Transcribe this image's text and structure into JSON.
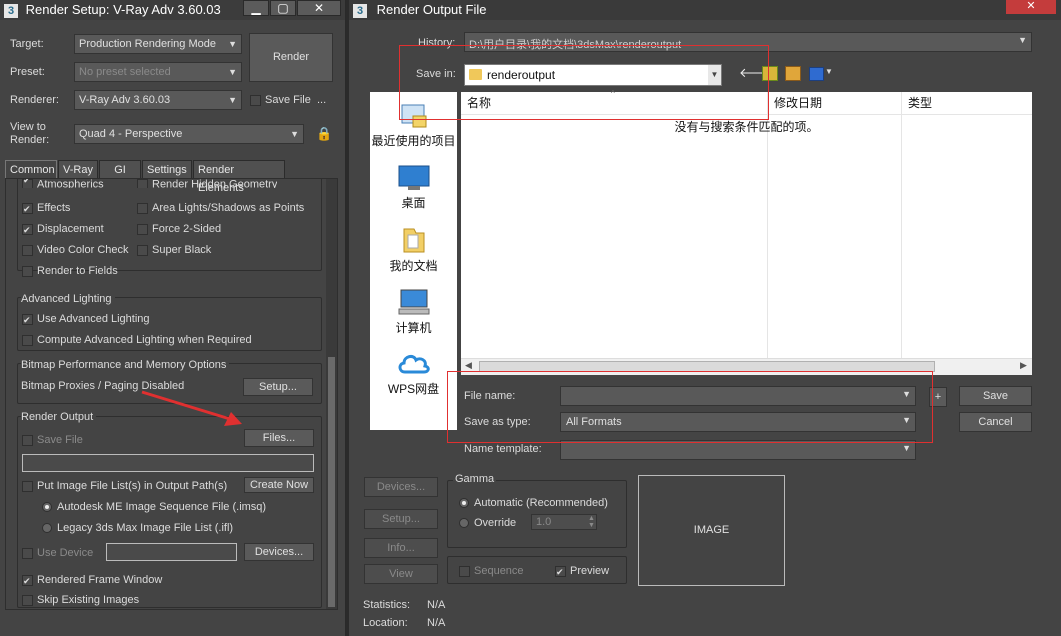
{
  "render_setup": {
    "title": "Render Setup: V-Ray Adv 3.60.03",
    "target_label": "Target:",
    "target_value": "Production Rendering Mode",
    "preset_label": "Preset:",
    "preset_value": "No preset selected",
    "renderer_label": "Renderer:",
    "renderer_value": "V-Ray Adv 3.60.03",
    "save_file_label": "Save File",
    "more_label": "...",
    "view_label": "View to Render:",
    "view_value": "Quad 4 - Perspective",
    "render_button": "Render",
    "tabs": [
      "Common",
      "V-Ray",
      "GI",
      "Settings",
      "Render Elements"
    ],
    "options": {
      "atmospherics": "Atmospherics",
      "render_hidden": "Render Hidden Geometry",
      "effects": "Effects",
      "area_lights": "Area Lights/Shadows as Points",
      "displacement": "Displacement",
      "force_2sided": "Force 2-Sided",
      "video_color": "Video Color Check",
      "super_black": "Super Black",
      "render_fields": "Render to Fields"
    },
    "advanced_lighting": {
      "title": "Advanced Lighting",
      "use_adv": "Use Advanced Lighting",
      "compute_adv": "Compute Advanced Lighting when Required"
    },
    "bitmap": {
      "title": "Bitmap Performance and Memory Options",
      "status": "Bitmap Proxies / Paging Disabled",
      "setup_button": "Setup..."
    },
    "render_output": {
      "title": "Render Output",
      "save_file": "Save File",
      "files_button": "Files...",
      "put_image_list": "Put Image File List(s) in Output Path(s)",
      "create_now": "Create Now",
      "autodesk_me": "Autodesk ME Image Sequence File (.imsq)",
      "legacy": "Legacy 3ds Max Image File List (.ifl)",
      "use_device": "Use Device",
      "devices_button": "Devices...",
      "rendered_frame": "Rendered Frame Window",
      "skip_existing": "Skip Existing Images"
    }
  },
  "output_file": {
    "title": "Render Output File",
    "history_label": "History:",
    "history_value": "D:\\用户目录\\我的文档\\3dsMax\\renderoutput",
    "save_in_label": "Save in:",
    "save_in_value": "renderoutput",
    "nav_items": [
      "最近使用的项目",
      "桌面",
      "我的文档",
      "计算机",
      "WPS网盘"
    ],
    "columns": [
      "名称",
      "修改日期",
      "类型"
    ],
    "empty_message": "没有与搜索条件匹配的项。",
    "file_name_label": "File name:",
    "save_type_label": "Save as type:",
    "save_type_value": "All Formats",
    "name_template_label": "Name template:",
    "save_button": "Save",
    "cancel_button": "Cancel",
    "plus_button": "+",
    "devices_button": "Devices...",
    "setup_button": "Setup...",
    "info_button": "Info...",
    "view_button": "View",
    "gamma_title": "Gamma",
    "gamma_auto": "Automatic (Recommended)",
    "gamma_override": "Override",
    "gamma_value": "1.0",
    "sequence_label": "Sequence",
    "preview_label": "Preview",
    "image_label": "IMAGE",
    "statistics_label": "Statistics:",
    "statistics_value": "N/A",
    "location_label": "Location:",
    "location_value": "N/A"
  },
  "colors": {
    "annotation": "#e03030",
    "window_bg": "#444444"
  }
}
